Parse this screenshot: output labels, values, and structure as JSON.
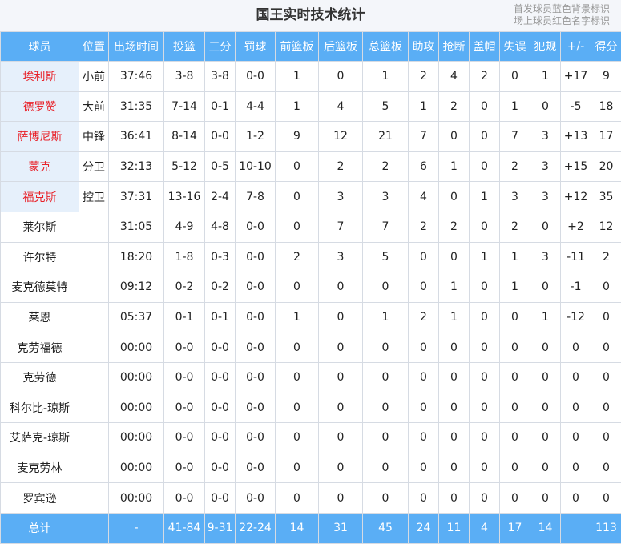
{
  "title": "国王实时技术统计",
  "legend": {
    "line1": "首发球员蓝色背景标识",
    "line2": "场上球员红色名字标识"
  },
  "colors": {
    "header_bg": "#5aaef5",
    "starter_bg": "#e6f0fb",
    "oncourt_name": "#e8222a"
  },
  "columns": [
    "球员",
    "位置",
    "出场时间",
    "投篮",
    "三分",
    "罚球",
    "前篮板",
    "后篮板",
    "总篮板",
    "助攻",
    "抢断",
    "盖帽",
    "失误",
    "犯规",
    "+/-",
    "得分"
  ],
  "players": [
    {
      "name": "埃利斯",
      "pos": "小前",
      "min": "37:46",
      "fg": "3-8",
      "tp": "3-8",
      "ft": "0-0",
      "oreb": "1",
      "dreb": "0",
      "reb": "1",
      "ast": "2",
      "stl": "4",
      "blk": "2",
      "tov": "0",
      "pf": "1",
      "pm": "+17",
      "pts": "9",
      "starter": true,
      "on_court": true
    },
    {
      "name": "德罗赞",
      "pos": "大前",
      "min": "31:35",
      "fg": "7-14",
      "tp": "0-1",
      "ft": "4-4",
      "oreb": "1",
      "dreb": "4",
      "reb": "5",
      "ast": "1",
      "stl": "2",
      "blk": "0",
      "tov": "1",
      "pf": "0",
      "pm": "-5",
      "pts": "18",
      "starter": true,
      "on_court": true
    },
    {
      "name": "萨博尼斯",
      "pos": "中锋",
      "min": "36:41",
      "fg": "8-14",
      "tp": "0-0",
      "ft": "1-2",
      "oreb": "9",
      "dreb": "12",
      "reb": "21",
      "ast": "7",
      "stl": "0",
      "blk": "0",
      "tov": "7",
      "pf": "3",
      "pm": "+13",
      "pts": "17",
      "starter": true,
      "on_court": true
    },
    {
      "name": "蒙克",
      "pos": "分卫",
      "min": "32:13",
      "fg": "5-12",
      "tp": "0-5",
      "ft": "10-10",
      "oreb": "0",
      "dreb": "2",
      "reb": "2",
      "ast": "6",
      "stl": "1",
      "blk": "0",
      "tov": "2",
      "pf": "3",
      "pm": "+15",
      "pts": "20",
      "starter": true,
      "on_court": true
    },
    {
      "name": "福克斯",
      "pos": "控卫",
      "min": "37:31",
      "fg": "13-16",
      "tp": "2-4",
      "ft": "7-8",
      "oreb": "0",
      "dreb": "3",
      "reb": "3",
      "ast": "4",
      "stl": "0",
      "blk": "1",
      "tov": "3",
      "pf": "3",
      "pm": "+12",
      "pts": "35",
      "starter": true,
      "on_court": true
    },
    {
      "name": "莱尔斯",
      "pos": "",
      "min": "31:05",
      "fg": "4-9",
      "tp": "4-8",
      "ft": "0-0",
      "oreb": "0",
      "dreb": "7",
      "reb": "7",
      "ast": "2",
      "stl": "2",
      "blk": "0",
      "tov": "2",
      "pf": "0",
      "pm": "+2",
      "pts": "12",
      "starter": false,
      "on_court": false
    },
    {
      "name": "许尔特",
      "pos": "",
      "min": "18:20",
      "fg": "1-8",
      "tp": "0-3",
      "ft": "0-0",
      "oreb": "2",
      "dreb": "3",
      "reb": "5",
      "ast": "0",
      "stl": "0",
      "blk": "1",
      "tov": "1",
      "pf": "3",
      "pm": "-11",
      "pts": "2",
      "starter": false,
      "on_court": false
    },
    {
      "name": "麦克德莫特",
      "pos": "",
      "min": "09:12",
      "fg": "0-2",
      "tp": "0-2",
      "ft": "0-0",
      "oreb": "0",
      "dreb": "0",
      "reb": "0",
      "ast": "0",
      "stl": "1",
      "blk": "0",
      "tov": "1",
      "pf": "0",
      "pm": "-1",
      "pts": "0",
      "starter": false,
      "on_court": false
    },
    {
      "name": "莱恩",
      "pos": "",
      "min": "05:37",
      "fg": "0-1",
      "tp": "0-1",
      "ft": "0-0",
      "oreb": "1",
      "dreb": "0",
      "reb": "1",
      "ast": "2",
      "stl": "1",
      "blk": "0",
      "tov": "0",
      "pf": "1",
      "pm": "-12",
      "pts": "0",
      "starter": false,
      "on_court": false
    },
    {
      "name": "克劳福德",
      "pos": "",
      "min": "00:00",
      "fg": "0-0",
      "tp": "0-0",
      "ft": "0-0",
      "oreb": "0",
      "dreb": "0",
      "reb": "0",
      "ast": "0",
      "stl": "0",
      "blk": "0",
      "tov": "0",
      "pf": "0",
      "pm": "0",
      "pts": "0",
      "starter": false,
      "on_court": false
    },
    {
      "name": "克劳德",
      "pos": "",
      "min": "00:00",
      "fg": "0-0",
      "tp": "0-0",
      "ft": "0-0",
      "oreb": "0",
      "dreb": "0",
      "reb": "0",
      "ast": "0",
      "stl": "0",
      "blk": "0",
      "tov": "0",
      "pf": "0",
      "pm": "0",
      "pts": "0",
      "starter": false,
      "on_court": false
    },
    {
      "name": "科尔比-琼斯",
      "pos": "",
      "min": "00:00",
      "fg": "0-0",
      "tp": "0-0",
      "ft": "0-0",
      "oreb": "0",
      "dreb": "0",
      "reb": "0",
      "ast": "0",
      "stl": "0",
      "blk": "0",
      "tov": "0",
      "pf": "0",
      "pm": "0",
      "pts": "0",
      "starter": false,
      "on_court": false
    },
    {
      "name": "艾萨克-琼斯",
      "pos": "",
      "min": "00:00",
      "fg": "0-0",
      "tp": "0-0",
      "ft": "0-0",
      "oreb": "0",
      "dreb": "0",
      "reb": "0",
      "ast": "0",
      "stl": "0",
      "blk": "0",
      "tov": "0",
      "pf": "0",
      "pm": "0",
      "pts": "0",
      "starter": false,
      "on_court": false
    },
    {
      "name": "麦克劳林",
      "pos": "",
      "min": "00:00",
      "fg": "0-0",
      "tp": "0-0",
      "ft": "0-0",
      "oreb": "0",
      "dreb": "0",
      "reb": "0",
      "ast": "0",
      "stl": "0",
      "blk": "0",
      "tov": "0",
      "pf": "0",
      "pm": "0",
      "pts": "0",
      "starter": false,
      "on_court": false
    },
    {
      "name": "罗宾逊",
      "pos": "",
      "min": "00:00",
      "fg": "0-0",
      "tp": "0-0",
      "ft": "0-0",
      "oreb": "0",
      "dreb": "0",
      "reb": "0",
      "ast": "0",
      "stl": "0",
      "blk": "0",
      "tov": "0",
      "pf": "0",
      "pm": "0",
      "pts": "0",
      "starter": false,
      "on_court": false
    }
  ],
  "totals": {
    "label": "总计",
    "pos": "",
    "min": "-",
    "fg": "41-84",
    "tp": "9-31",
    "ft": "22-24",
    "oreb": "14",
    "dreb": "31",
    "reb": "45",
    "ast": "24",
    "stl": "11",
    "blk": "4",
    "tov": "17",
    "pf": "14",
    "pm": "",
    "pts": "113"
  }
}
